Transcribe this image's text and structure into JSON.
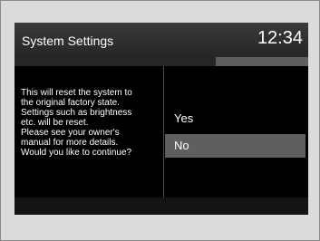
{
  "header": {
    "title": "System Settings",
    "clock": "12:34"
  },
  "dialog": {
    "message_lines": [
      "This will reset the system to",
      "the original factory state.",
      "Settings such as brightness",
      "etc. will be reset.",
      "Please see your owner's",
      "manual for more details.",
      "Would you like to continue?"
    ],
    "options": [
      {
        "label": "Yes",
        "selected": false
      },
      {
        "label": "No",
        "selected": true
      }
    ]
  },
  "colors": {
    "screen_background": "#0b0b0b",
    "selected_option": "#5f5f5f",
    "text": "#ffffff"
  }
}
